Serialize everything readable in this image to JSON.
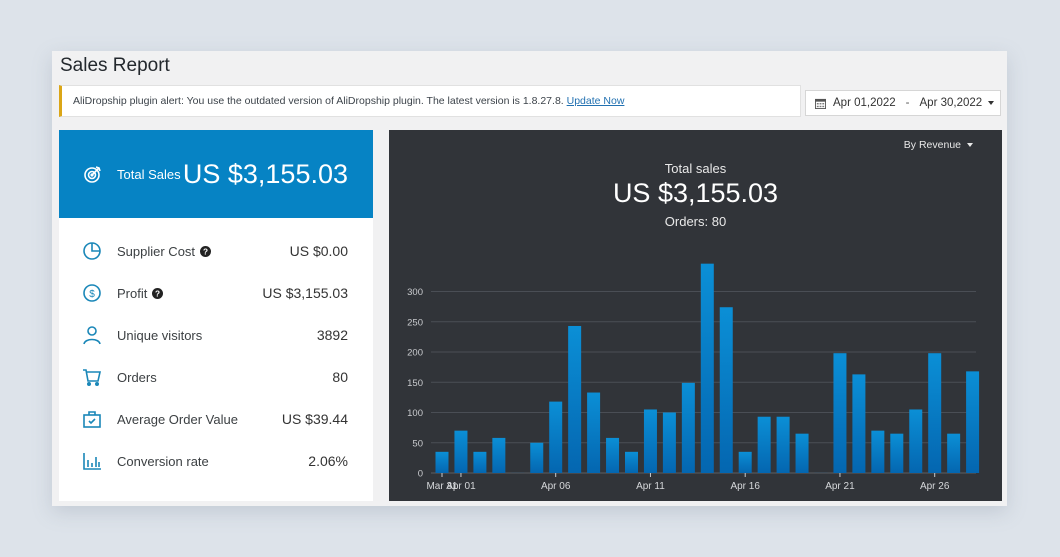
{
  "page": {
    "title": "Sales Report"
  },
  "notice": {
    "text": "AliDropship plugin alert: You use the outdated version of AliDropship plugin. The latest version is 1.8.27.8.",
    "link": "Update Now",
    "accent": "#dba617"
  },
  "date_range": {
    "from": "Apr 01,2022",
    "separator": "-",
    "to": "Apr 30,2022",
    "icon": "calendar-icon"
  },
  "summary": {
    "hero": {
      "label": "Total Sales",
      "value": "US $3,155.03",
      "icon": "target-icon",
      "color": "#0683c4"
    },
    "rows": [
      {
        "label": "Supplier Cost",
        "value": "US $0.00",
        "icon": "pie-chart-icon",
        "help": true
      },
      {
        "label": "Profit",
        "value": "US $3,155.03",
        "icon": "dollar-circle-icon",
        "help": true
      },
      {
        "label": "Unique visitors",
        "value": "3892",
        "icon": "user-icon",
        "help": false
      },
      {
        "label": "Orders",
        "value": "80",
        "icon": "cart-icon",
        "help": false
      },
      {
        "label": "Average Order Value",
        "value": "US $39.44",
        "icon": "shopping-bag-icon",
        "help": false
      },
      {
        "label": "Conversion rate",
        "value": "2.06%",
        "icon": "bar-chart-icon",
        "help": false
      }
    ]
  },
  "chart_panel": {
    "dropdown": "By Revenue",
    "title": "Total sales",
    "total": "US $3,155.03",
    "orders": "Orders: 80"
  },
  "chart_data": {
    "type": "bar",
    "title": "Total sales",
    "xlabel": "",
    "ylabel": "",
    "ylim": [
      0,
      350
    ],
    "yticks": [
      0,
      50,
      100,
      150,
      200,
      250,
      300
    ],
    "grid": true,
    "bar_color": "#0a86cf",
    "categories": [
      "Mar 31",
      "Apr 01",
      "Apr 02",
      "Apr 03",
      "Apr 04",
      "Apr 05",
      "Apr 06",
      "Apr 07",
      "Apr 08",
      "Apr 09",
      "Apr 10",
      "Apr 11",
      "Apr 12",
      "Apr 13",
      "Apr 14",
      "Apr 15",
      "Apr 16",
      "Apr 17",
      "Apr 18",
      "Apr 19",
      "Apr 20",
      "Apr 21",
      "Apr 22",
      "Apr 23",
      "Apr 24",
      "Apr 25",
      "Apr 26",
      "Apr 27",
      "Apr 28"
    ],
    "values": [
      35,
      70,
      35,
      58,
      0,
      50,
      118,
      243,
      133,
      58,
      35,
      105,
      100,
      149,
      346,
      274,
      35,
      93,
      93,
      65,
      0,
      198,
      163,
      70,
      65,
      105,
      198,
      65,
      168
    ],
    "xtick_labels": [
      "Mar 31",
      "Apr 01",
      "Apr 06",
      "Apr 11",
      "Apr 16",
      "Apr 21",
      "Apr 26"
    ]
  }
}
